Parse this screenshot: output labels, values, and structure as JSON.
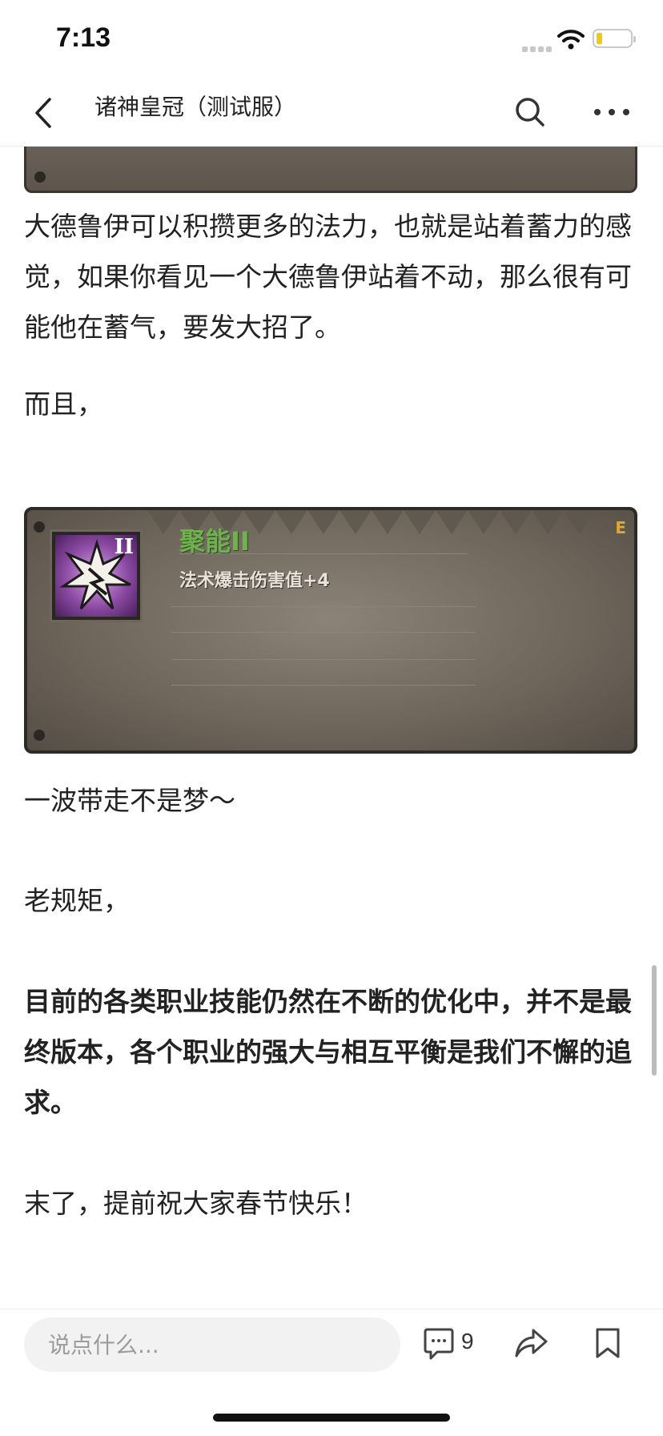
{
  "status_bar": {
    "time": "7:13"
  },
  "nav": {
    "title": "诸神皇冠（测试服）"
  },
  "article": {
    "paragraphs": [
      "大德鲁伊可以积攒更多的法力，也就是站着蓄力的感觉，如果你看见一个大德鲁伊站着不动，那么很有可能他在蓄气，要发大招了。",
      "而且，",
      "一波带走不是梦～",
      "老规矩，",
      "目前的各类职业技能仍然在不断的优化中，并不是最终版本，各个职业的强大与相互平衡是我们不懈的追求。",
      "末了，提前祝大家春节快乐！"
    ],
    "skill_card": {
      "name": "聚能II",
      "description": "法术爆击伤害值+4",
      "roman": "II",
      "tag": "E"
    }
  },
  "bottom_bar": {
    "comment_placeholder": "说点什么...",
    "comment_count": "9"
  },
  "icons": {
    "back": "back-chevron-icon",
    "search": "search-icon",
    "more": "more-dots-icon",
    "comment": "comment-icon",
    "share": "share-icon",
    "bookmark": "bookmark-icon"
  },
  "colors": {
    "skill_name": "#6fb14e",
    "battery_level": "#f2c718"
  }
}
